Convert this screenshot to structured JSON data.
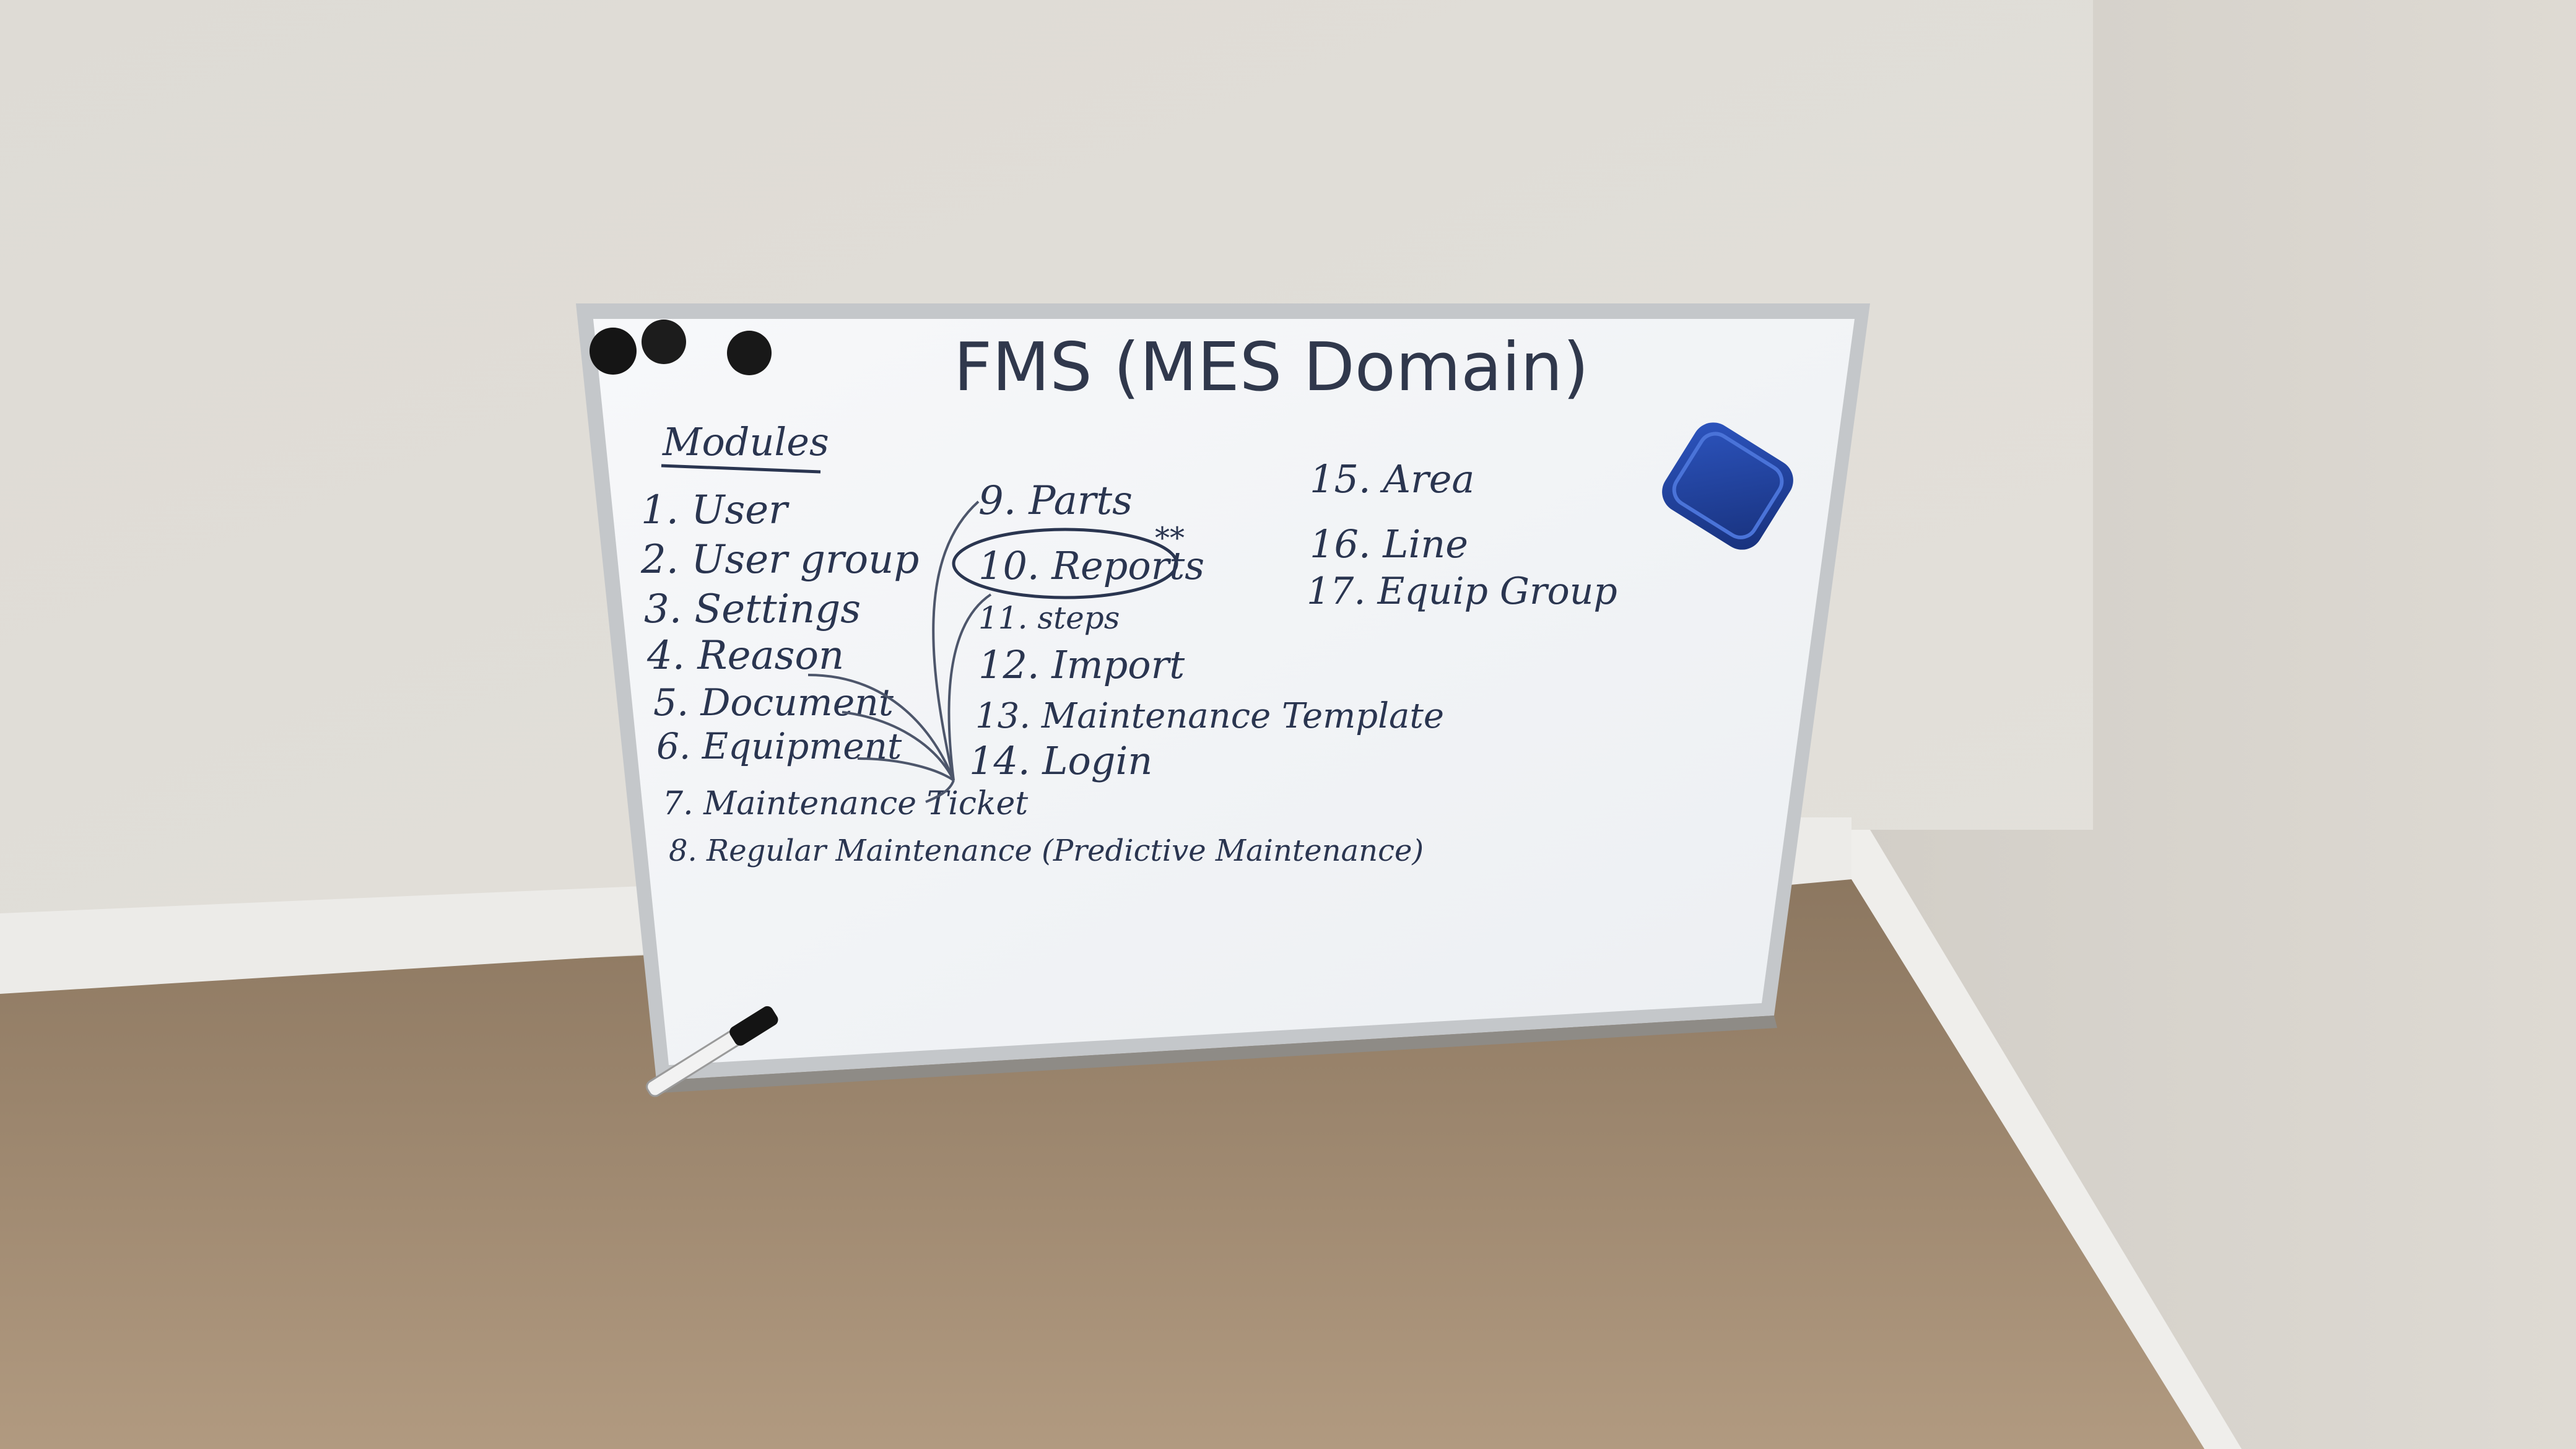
{
  "board": {
    "title": "FMS (MES Domain)",
    "section_heading": "Modules",
    "column1": [
      "1. User",
      "2. User group",
      "3. Settings",
      "4. Reason",
      "5. Document",
      "6. Equipment",
      "7. Maintenance Ticket",
      "8. Regular Maintenance (Predictive Maintenance)"
    ],
    "column2": [
      "9. Parts",
      "10. Reports",
      "11. steps",
      "12. Import",
      "13. Maintenance Template",
      "14. Login"
    ],
    "column2_mark": "**",
    "column3": [
      "15. Area",
      "16. Line",
      "17. Equip Group"
    ]
  },
  "objects": {
    "magnets": [
      "magnet-icon",
      "magnet-icon",
      "magnet-icon"
    ],
    "eraser": "whiteboard-eraser-icon",
    "marker": "marker-pen-icon"
  },
  "colors": {
    "wall_left": "#e0ddd7",
    "wall_right": "#d6d2cb",
    "carpet": "#a38d74",
    "board_surface": "#f4f6f8",
    "board_frame": "#bfc2c5",
    "ink": "#2a3550",
    "eraser": "#1f3f9a",
    "magnet": "#1a1a1a"
  }
}
